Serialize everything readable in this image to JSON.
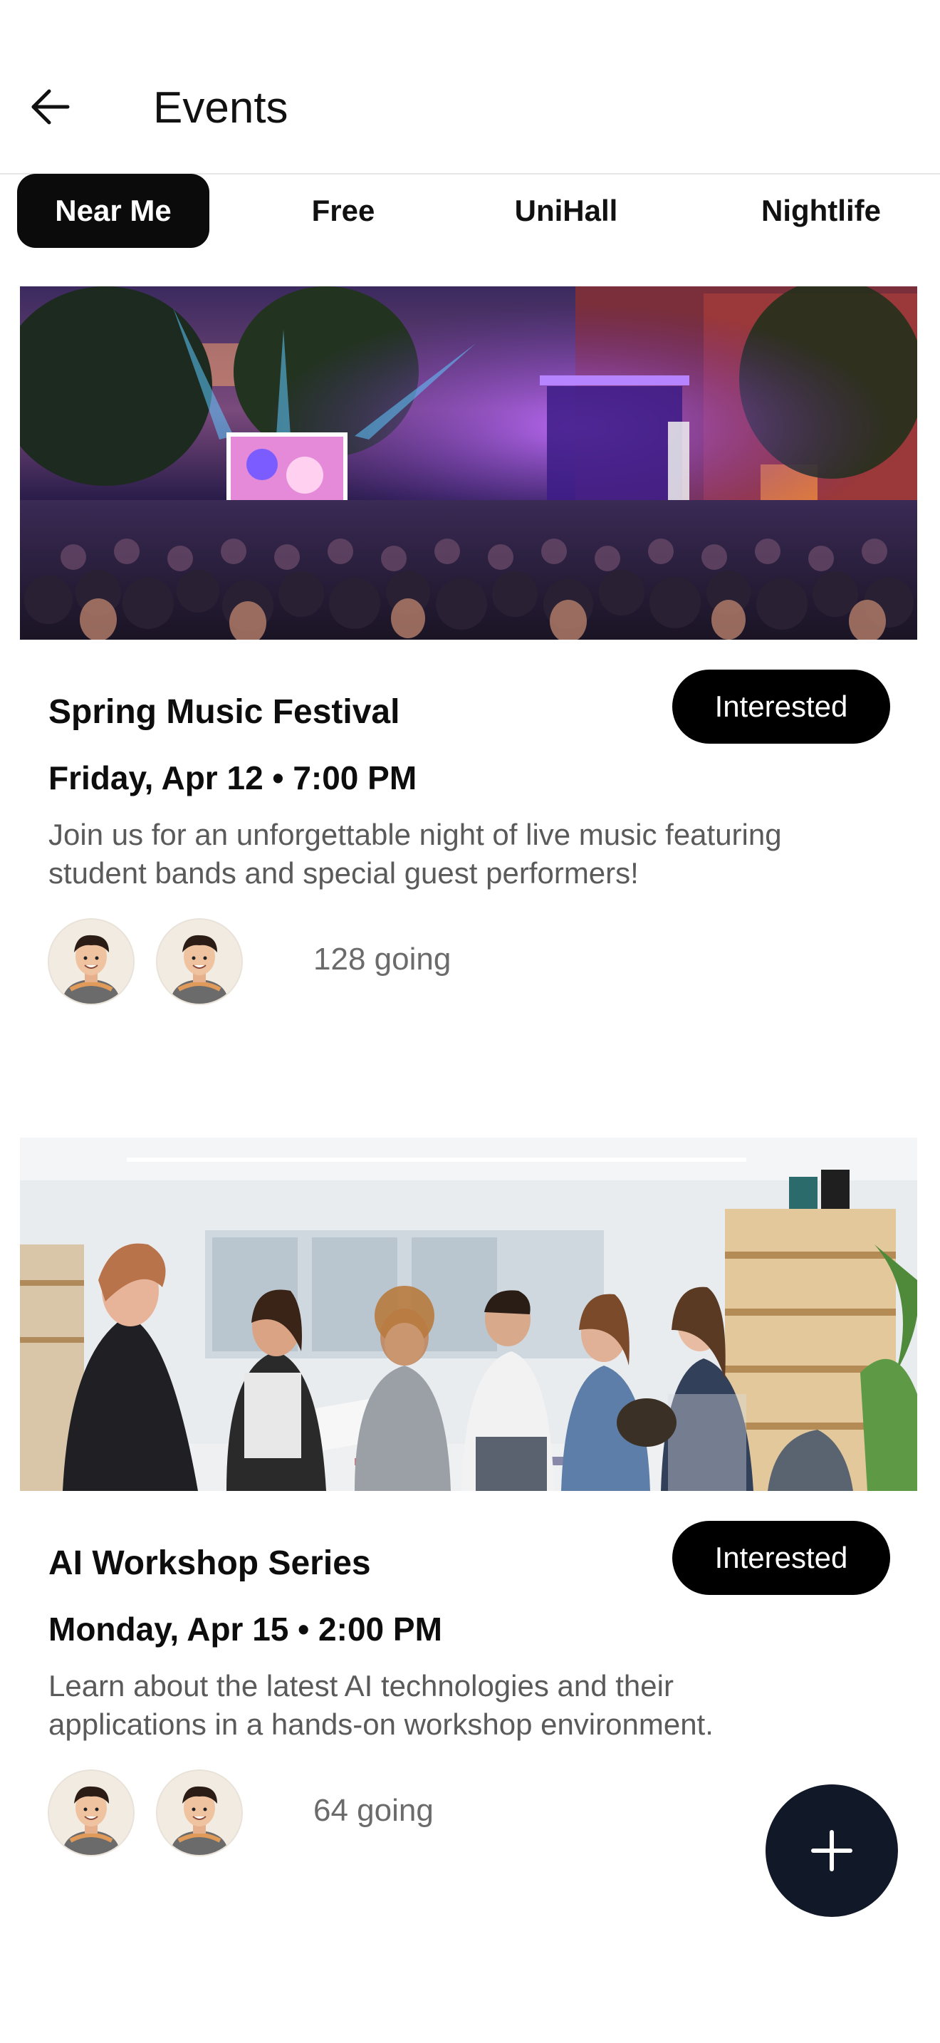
{
  "header": {
    "title": "Events",
    "back_icon": "arrow-left-icon"
  },
  "filters": [
    {
      "label": "Near Me",
      "active": true
    },
    {
      "label": "Free",
      "active": false
    },
    {
      "label": "UniHall",
      "active": false
    },
    {
      "label": "Nightlife",
      "active": false
    }
  ],
  "events": [
    {
      "title": "Spring Music Festival",
      "button": "Interested",
      "datetime": "Friday, Apr 12 • 7:00 PM",
      "description_line1": "Join us for an unforgettable night of live music featuring",
      "description_line2": "student bands and special guest performers!",
      "going": "128 going",
      "image": "outdoor-concert-photo"
    },
    {
      "title": "AI Workshop Series",
      "button": "Interested",
      "datetime": "Monday, Apr 15 • 2:00 PM",
      "description_line1": "Learn about the latest AI technologies and their",
      "description_line2": "applications in a hands-on workshop environment.",
      "going": "64 going",
      "image": "workshop-people-photo"
    }
  ],
  "fab": {
    "icon": "plus-icon"
  },
  "colors": {
    "primary": "#0b0b0b",
    "fab": "#111827",
    "muted": "#5a5a5a"
  }
}
